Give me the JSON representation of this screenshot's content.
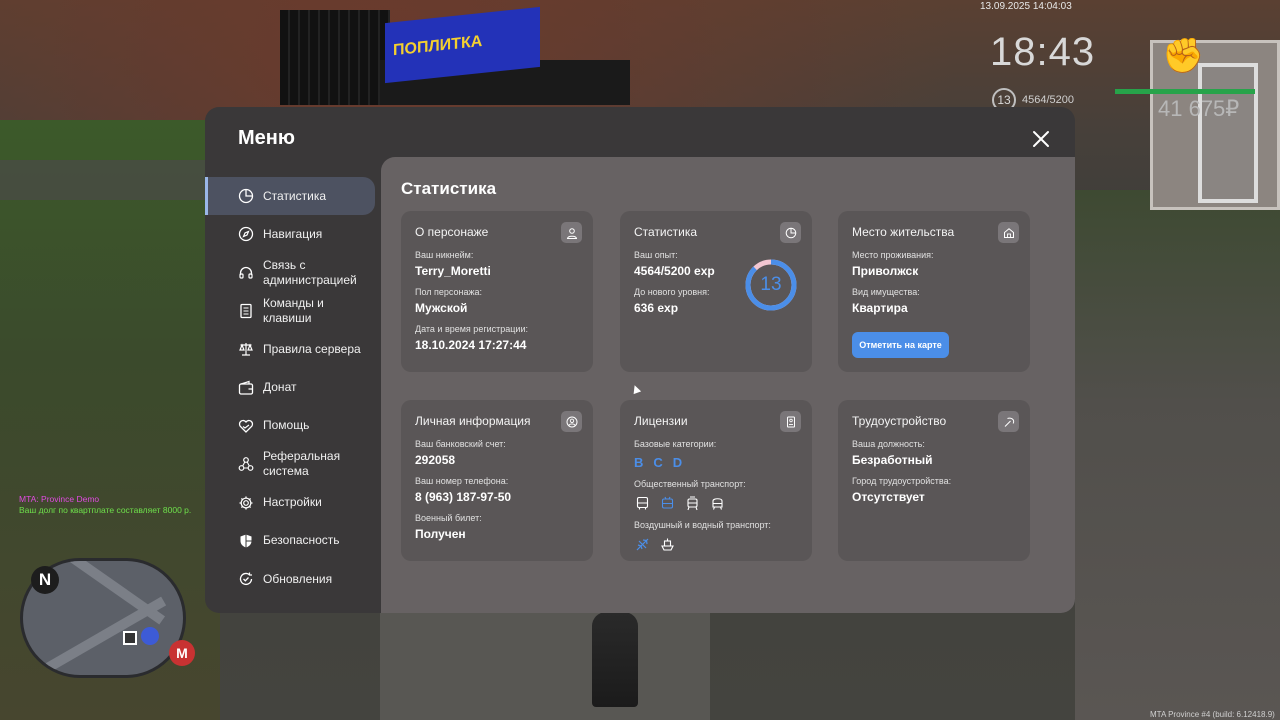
{
  "hud": {
    "datetime": "13.09.2025 14:04:03",
    "clock": "18:43",
    "level": "13",
    "exp": "4564/5200",
    "money": "41 675₽",
    "chat": [
      "MTA: Province Demo",
      "Ваш долг по квартплате составляет 8000 р."
    ],
    "map_north": "N",
    "map_metro": "M",
    "build": "MTA Province #4 (build: 6.12418.9)"
  },
  "billboard": {
    "text": "ПОПЛИТКА"
  },
  "menu": {
    "title": "Меню",
    "sidebar": [
      {
        "label": "Статистика",
        "icon": "stats-icon"
      },
      {
        "label": "Навигация",
        "icon": "compass-icon"
      },
      {
        "label": "Связь с администрацией",
        "icon": "headset-icon"
      },
      {
        "label": "Команды и клавиши",
        "icon": "document-icon"
      },
      {
        "label": "Правила сервера",
        "icon": "scales-icon"
      },
      {
        "label": "Донат",
        "icon": "wallet-icon"
      },
      {
        "label": "Помощь",
        "icon": "heart-hand-icon"
      },
      {
        "label": "Реферальная система",
        "icon": "referral-icon"
      },
      {
        "label": "Настройки",
        "icon": "gear-icon"
      },
      {
        "label": "Безопасность",
        "icon": "shield-icon"
      },
      {
        "label": "Обновления",
        "icon": "update-icon"
      }
    ],
    "active_item": "Статистика",
    "accent": "#4b8ee8"
  },
  "content": {
    "title": "Статистика",
    "character": {
      "title": "О персонаже",
      "nickname_label": "Ваш никнейм:",
      "nickname": "Terry_Moretti",
      "gender_label": "Пол персонажа:",
      "gender": "Мужской",
      "reg_label": "Дата и время регистрации:",
      "reg": "18.10.2024 17:27:44"
    },
    "stats": {
      "title": "Статистика",
      "exp_label": "Ваш опыт:",
      "exp": "4564/5200 exp",
      "next_label": "До нового уровня:",
      "next": "636 exp",
      "level": "13",
      "progress": 0.8777
    },
    "residence": {
      "title": "Место жительства",
      "place_label": "Место проживания:",
      "place": "Приволжск",
      "property_label": "Вид имущества:",
      "property": "Квартира",
      "button": "Отметить на карте"
    },
    "personal": {
      "title": "Личная информация",
      "bank_label": "Ваш банковский счет:",
      "bank": "292058",
      "phone_label": "Ваш номер телефона:",
      "phone": "8 (963) 187-97-50",
      "military_label": "Военный билет:",
      "military": "Получен"
    },
    "licenses": {
      "title": "Лицензии",
      "base_label": "Базовые категории:",
      "categories": [
        "B",
        "C",
        "D"
      ],
      "public_label": "Общественный транспорт:",
      "air_label": "Воздушный и водный транспорт:"
    },
    "employment": {
      "title": "Трудоустройство",
      "position_label": "Ваша должность:",
      "position": "Безработный",
      "city_label": "Город трудоустройства:",
      "city": "Отсутствует"
    }
  }
}
